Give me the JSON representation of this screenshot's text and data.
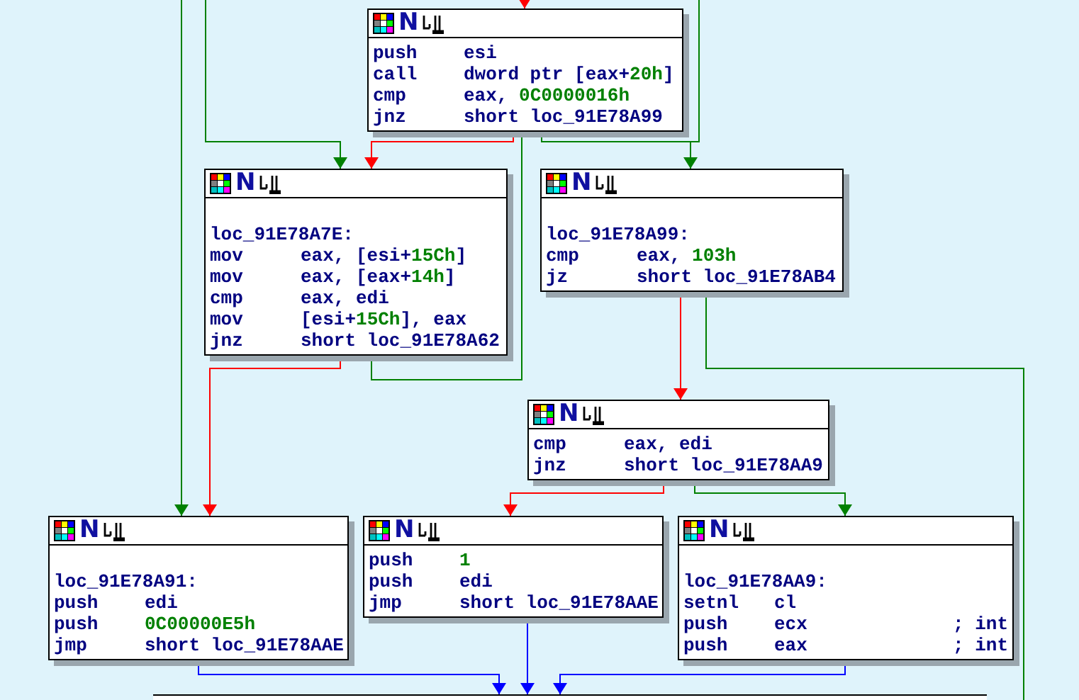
{
  "nodes": [
    {
      "header": "N",
      "lines": [
        {
          "kind": "instr",
          "mnemonic": "push",
          "operands": [
            {
              "kind": "text",
              "text": "esi"
            }
          ]
        },
        {
          "kind": "instr",
          "mnemonic": "call",
          "operands": [
            {
              "kind": "text",
              "text": "dword ptr [eax+"
            },
            {
              "kind": "number",
              "text": "20h"
            },
            {
              "kind": "text",
              "text": "]"
            }
          ]
        },
        {
          "kind": "instr",
          "mnemonic": "cmp",
          "operands": [
            {
              "kind": "text",
              "text": "eax, "
            },
            {
              "kind": "number",
              "text": "0C0000016h"
            }
          ]
        },
        {
          "kind": "instr",
          "mnemonic": "jnz",
          "operands": [
            {
              "kind": "text",
              "text": "short loc_91E78A99"
            }
          ]
        }
      ]
    },
    {
      "header": "N",
      "lines": [
        {
          "kind": "label",
          "text": "loc_91E78A7E:"
        },
        {
          "kind": "instr",
          "mnemonic": "mov",
          "operands": [
            {
              "kind": "text",
              "text": "eax, [esi+"
            },
            {
              "kind": "number",
              "text": "15Ch"
            },
            {
              "kind": "text",
              "text": "]"
            }
          ]
        },
        {
          "kind": "instr",
          "mnemonic": "mov",
          "operands": [
            {
              "kind": "text",
              "text": "eax, [eax+"
            },
            {
              "kind": "number",
              "text": "14h"
            },
            {
              "kind": "text",
              "text": "]"
            }
          ]
        },
        {
          "kind": "instr",
          "mnemonic": "cmp",
          "operands": [
            {
              "kind": "text",
              "text": "eax, edi"
            }
          ]
        },
        {
          "kind": "instr",
          "mnemonic": "mov",
          "operands": [
            {
              "kind": "text",
              "text": "[esi+"
            },
            {
              "kind": "number",
              "text": "15Ch"
            },
            {
              "kind": "text",
              "text": "], eax"
            }
          ]
        },
        {
          "kind": "instr",
          "mnemonic": "jnz",
          "operands": [
            {
              "kind": "text",
              "text": "short loc_91E78A62"
            }
          ]
        }
      ]
    },
    {
      "header": "N",
      "lines": [
        {
          "kind": "label",
          "text": "loc_91E78A99:"
        },
        {
          "kind": "instr",
          "mnemonic": "cmp",
          "operands": [
            {
              "kind": "text",
              "text": "eax, "
            },
            {
              "kind": "number",
              "text": "103h"
            }
          ]
        },
        {
          "kind": "instr",
          "mnemonic": "jz",
          "operands": [
            {
              "kind": "text",
              "text": "short loc_91E78AB4"
            }
          ]
        }
      ]
    },
    {
      "header": "N",
      "lines": [
        {
          "kind": "instr",
          "mnemonic": "cmp",
          "operands": [
            {
              "kind": "text",
              "text": "eax, edi"
            }
          ]
        },
        {
          "kind": "instr",
          "mnemonic": "jnz",
          "operands": [
            {
              "kind": "text",
              "text": "short loc_91E78AA9"
            }
          ]
        }
      ]
    },
    {
      "header": "N",
      "lines": [
        {
          "kind": "label",
          "text": "loc_91E78A91:"
        },
        {
          "kind": "instr",
          "mnemonic": "push",
          "operands": [
            {
              "kind": "text",
              "text": "edi"
            }
          ]
        },
        {
          "kind": "instr",
          "mnemonic": "push",
          "operands": [
            {
              "kind": "number",
              "text": "0C00000E5h"
            }
          ]
        },
        {
          "kind": "instr",
          "mnemonic": "jmp",
          "operands": [
            {
              "kind": "text",
              "text": "short loc_91E78AAE"
            }
          ]
        }
      ]
    },
    {
      "header": "N",
      "lines": [
        {
          "kind": "instr",
          "mnemonic": "push",
          "operands": [
            {
              "kind": "number",
              "text": "1"
            }
          ]
        },
        {
          "kind": "instr",
          "mnemonic": "push",
          "operands": [
            {
              "kind": "text",
              "text": "edi"
            }
          ]
        },
        {
          "kind": "instr",
          "mnemonic": "jmp",
          "operands": [
            {
              "kind": "text",
              "text": "short loc_91E78AAE"
            }
          ]
        }
      ]
    },
    {
      "header": "N",
      "lines": [
        {
          "kind": "label",
          "text": "loc_91E78AA9:"
        },
        {
          "kind": "instr",
          "mnemonic": "setnl",
          "operands": [
            {
              "kind": "text",
              "text": "cl"
            }
          ]
        },
        {
          "kind": "instr",
          "mnemonic": "push",
          "operands": [
            {
              "kind": "text",
              "text": "ecx"
            }
          ],
          "comment": "; int"
        },
        {
          "kind": "instr",
          "mnemonic": "push",
          "operands": [
            {
              "kind": "text",
              "text": "eax"
            }
          ],
          "comment": "; int"
        }
      ]
    }
  ],
  "edges": [
    {
      "kind": "true"
    },
    {
      "kind": "false"
    },
    {
      "kind": "true"
    },
    {
      "kind": "false"
    },
    {
      "kind": "true"
    },
    {
      "kind": "true"
    },
    {
      "kind": "true"
    },
    {
      "kind": "false"
    },
    {
      "kind": "false"
    },
    {
      "kind": "true"
    },
    {
      "kind": "false"
    },
    {
      "kind": "true"
    },
    {
      "kind": "jump"
    },
    {
      "kind": "jump"
    },
    {
      "kind": "jump"
    }
  ]
}
